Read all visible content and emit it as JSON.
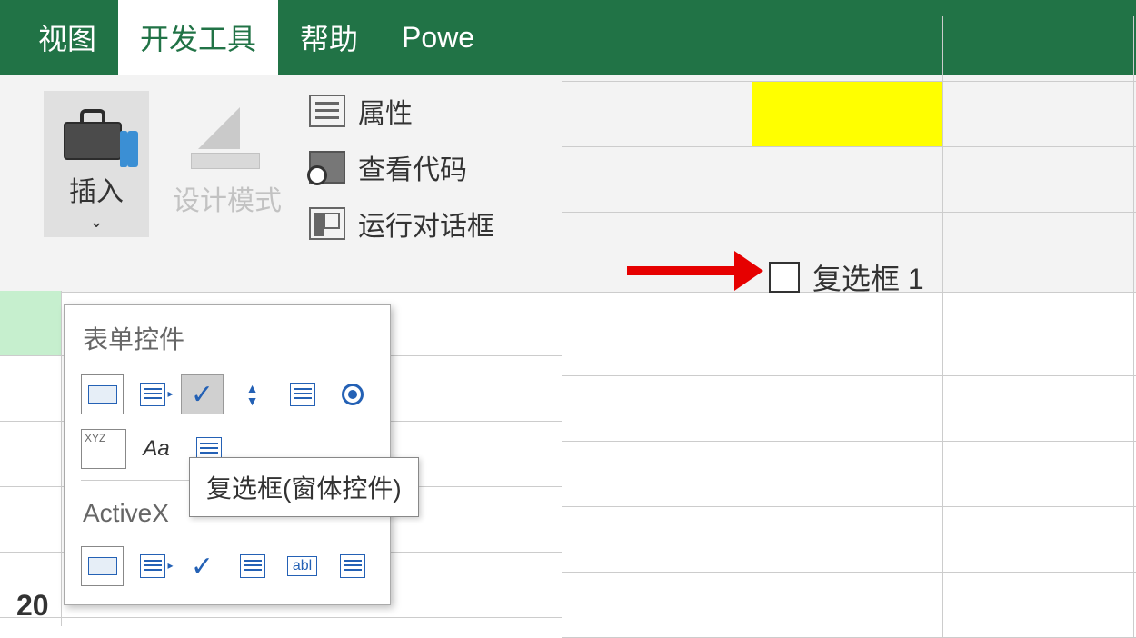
{
  "ribbon": {
    "tabs": {
      "view": "视图",
      "developer": "开发工具",
      "help": "帮助",
      "power": "Powe"
    },
    "insert_label": "插入",
    "design_mode_label": "设计模式",
    "properties_label": "属性",
    "view_code_label": "查看代码",
    "run_dialog_label": "运行对话框"
  },
  "controls_popup": {
    "form_controls_title": "表单控件",
    "activex_title": "ActiveX"
  },
  "tooltip_text": "复选框(窗体控件)",
  "checkbox_label": "复选框 1",
  "row_number": "20"
}
